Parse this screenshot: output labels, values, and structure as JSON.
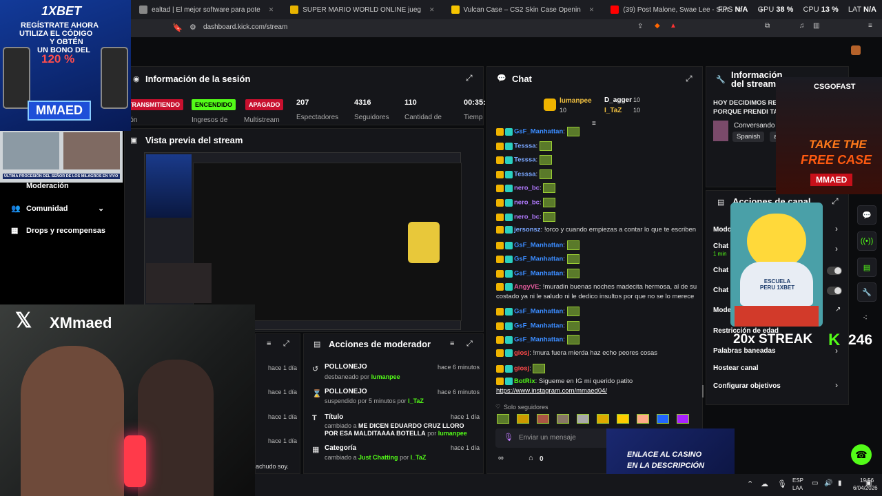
{
  "browser": {
    "tabs": [
      {
        "label": "ealtad | El mejor software para pote",
        "color": "#888"
      },
      {
        "label": "SUPER MARIO WORLD ONLINE jueg",
        "color": "#e8b400"
      },
      {
        "label": "Vulcan Case – CS2 Skin Case Openin",
        "color": "#f5c400"
      },
      {
        "label": "(39) Post Malone, Swae Lee - Sun",
        "color": "#ff0000"
      }
    ],
    "new_tab": "+",
    "url": "dashboard.kick.com/stream",
    "stats": {
      "fps_label": "FPS",
      "fps_val": "N/A",
      "gpu_label": "GPU",
      "gpu_val": "38 %",
      "cpu_label": "CPU",
      "cpu_val": "13 %",
      "lat_label": "LAT",
      "lat_val": "N/A"
    }
  },
  "ad_top": {
    "brand": "1XBET",
    "line1": "REGÍSTRATE AHORA",
    "line2": "UTILIZA EL CÓDIGO",
    "line3": "Y OBTÉN",
    "line4": "UN BONO DEL",
    "bonus": "120 %",
    "code": "MMAED",
    "caption": "ÚLTIMA PROCESIÓN DEL SEÑOR DE LOS MILAGROS EN VIVO"
  },
  "session": {
    "title": "Información de la sesión",
    "badges": [
      {
        "label": "TRANSMITIENDO",
        "sub": "sión"
      },
      {
        "label": "ENCENDIDO",
        "sub": "Ingresos de"
      },
      {
        "label": "APAGADO",
        "sub": "Multistream"
      }
    ],
    "stats": [
      {
        "value": "207",
        "label": "Espectadores"
      },
      {
        "value": "4316",
        "label": "Seguidores"
      },
      {
        "value": "110",
        "label": "Cantidad de"
      },
      {
        "value": "00:35:",
        "label": "Tiemp"
      }
    ]
  },
  "preview": {
    "title": "Vista previa del stream"
  },
  "sidebar": {
    "items": [
      {
        "label": "Moderación"
      },
      {
        "label": "Comunidad"
      },
      {
        "label": "Drops y recompensas"
      }
    ]
  },
  "webcam": {
    "handle": "XMmaed",
    "partial_text": "achudo soy."
  },
  "left_log": {
    "times": [
      "hace 1 día",
      "hace 1 día",
      "hace 1 día",
      "hace 1 día"
    ]
  },
  "mod_actions": {
    "title": "Acciones de moderador",
    "rows": [
      {
        "title": "POLLONEJO",
        "time": "hace 6 minutos",
        "pre": "desbaneado por",
        "by": "lumanpee",
        "mid": "",
        "post": ""
      },
      {
        "title": "POLLONEJO",
        "time": "hace 6 minutos",
        "pre": "suspendido por 5 minutos por",
        "by": "I_TaZ",
        "mid": "",
        "post": ""
      },
      {
        "title": "Título",
        "time": "hace 1 día",
        "pre": "cambiado a",
        "mid": "ME DICEN EDUARDO CRUZ LLORO POR ESA MALDITAAAA BOTELLA",
        "post": "por",
        "by": "lumanpee"
      },
      {
        "title": "Categoría",
        "time": "hace 1 día",
        "pre": "cambiado a",
        "mid": "Just Chatting",
        "post": "por",
        "by": "I_TaZ"
      }
    ]
  },
  "chat": {
    "title": "Chat",
    "top_gifters": [
      {
        "name": "lumanpee",
        "count": "10"
      },
      {
        "name": "D_agger",
        "count": "10"
      },
      {
        "name": "I_TaZ",
        "count": "10"
      }
    ],
    "messages": [
      {
        "user": "GsF_Manhattan",
        "text": "",
        "color": "#3b8cff",
        "emote": true
      },
      {
        "user": "Tesssa",
        "text": "",
        "color": "#7aa7ff",
        "emote": true
      },
      {
        "user": "Tesssa",
        "text": "",
        "color": "#7aa7ff",
        "emote": true
      },
      {
        "user": "Tesssa",
        "text": "",
        "color": "#7aa7ff",
        "emote": true
      },
      {
        "user": "nero_bc",
        "text": "",
        "color": "#b27bff",
        "emote": true
      },
      {
        "user": "nero_bc",
        "text": "",
        "color": "#b27bff",
        "emote": true
      },
      {
        "user": "nero_bc",
        "text": "",
        "color": "#b27bff",
        "emote": true
      },
      {
        "user": "jersonsz",
        "text": "!orco y cuando empiezas a contar lo que te escriben",
        "color": "#7aa7ff",
        "emote": false
      },
      {
        "user": "GsF_Manhattan",
        "text": "",
        "color": "#3b8cff",
        "emote": true
      },
      {
        "user": "GsF_Manhattan",
        "text": "",
        "color": "#3b8cff",
        "emote": true
      },
      {
        "user": "GsF_Manhattan",
        "text": "",
        "color": "#3b8cff",
        "emote": true
      },
      {
        "user": "AngyVE",
        "text": "!muradin buenas noches madecita hermosa, al de su",
        "color": "#e05a9a",
        "emote": false
      },
      {
        "user": "",
        "text": "costado ya ni le saludo ni le dedico insultos por que no se lo merece",
        "color": "#ddd",
        "emote": false
      },
      {
        "user": "GsF_Manhattan",
        "text": "",
        "color": "#3b8cff",
        "emote": true
      },
      {
        "user": "GsF_Manhattan",
        "text": "",
        "color": "#3b8cff",
        "emote": true
      },
      {
        "user": "GsF_Manhattan",
        "text": "",
        "color": "#3b8cff",
        "emote": true
      },
      {
        "user": "giosj",
        "text": "!mura fuera mierda haz echo peores cosas",
        "color": "#ff4a4a",
        "emote": false
      },
      {
        "user": "giosj",
        "text": "",
        "color": "#ff4a4a",
        "emote": true
      },
      {
        "user": "BotRix",
        "text": "Sigueme en IG mi querido patito",
        "color": "#53fc18",
        "emote": false
      },
      {
        "user": "",
        "text": "https://www.instagram.com/mmaed04/",
        "color": "#fff",
        "emote": false
      }
    ],
    "followers_only": "Solo seguidores",
    "input_placeholder": "Enviar un mensaje",
    "footer_count": "0"
  },
  "stream_info": {
    "title": "Información del stream",
    "text": "HOY DECIDIMOS RE PORQUE PRENDI TA",
    "category": "Conversando",
    "language": "Spanish",
    "extra": "a"
  },
  "channel_actions": {
    "title": "Acciones de canal",
    "items": [
      {
        "label": "Modo",
        "sub": ""
      },
      {
        "label": "Chat c",
        "sub": "1 min"
      },
      {
        "label": "Chat c",
        "sub": ""
      },
      {
        "label": "Chat c",
        "sub": ""
      },
      {
        "label": "Mode",
        "sub": ""
      },
      {
        "label": "Restricción de edad",
        "sub": ""
      },
      {
        "label": "Palabras baneadas",
        "sub": ""
      },
      {
        "label": "Hostear canal",
        "sub": ""
      },
      {
        "label": "Configurar objetivos",
        "sub": ""
      }
    ]
  },
  "overlays": {
    "streak_label": "20x STREAK",
    "streak_value": "246",
    "csgo": {
      "brand": "CSGOFAST",
      "line1": "TAKE THE",
      "line2": "FREE CASE",
      "code": "MMAED"
    },
    "casino": {
      "line1": "ENLACE AL CASINO",
      "line2": "EN LA DESCRIPCIÓN"
    },
    "duck_shirt": "ESCUELA PERU 1XBET"
  },
  "taskbar": {
    "lang1": "ESP",
    "lang2": "LAA",
    "time": "19:56",
    "date": "6/04/2026"
  },
  "colors": {
    "kick_green": "#53fc18",
    "badge_red": "#c8102e"
  }
}
